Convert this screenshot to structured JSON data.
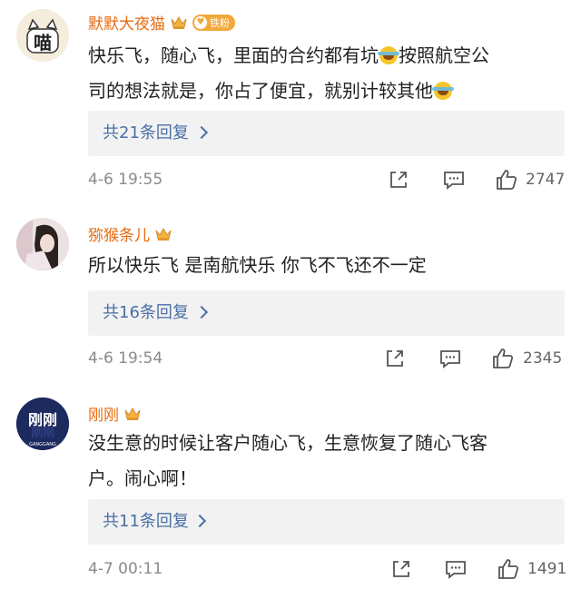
{
  "colors": {
    "username": "#e86b0f",
    "reply_link": "#4a6fa5",
    "timestamp": "#8a8a8a",
    "reply_bg": "#f2f2f2",
    "fan_badge": "#f2a83b"
  },
  "icons": [
    "crown-icon",
    "share-icon",
    "comment-icon",
    "like-icon",
    "chevron-right-icon",
    "laugh-cry-emoji"
  ],
  "comments": [
    {
      "username": "默默大夜猫",
      "fan_badge": "铁粉",
      "text_line1": "快乐飞，随心飞，里面的合约都有坑",
      "text_line1b": "按照航空公",
      "text_line2": "司的想法就是，你占了便宜，就别计较其他",
      "reply_link": "共21条回复",
      "timestamp": "4-6 19:55",
      "likes": "2747"
    },
    {
      "username": "猕猴条儿",
      "text": "所以快乐飞 是南航快乐 你飞不飞还不一定",
      "reply_link": "共16条回复",
      "timestamp": "4-6 19:54",
      "likes": "2345"
    },
    {
      "username": "刚刚",
      "avatar_text": "刚刚",
      "avatar_sub": "GANGGANG",
      "text_line1": "没生意的时候让客户随心飞，生意恢复了随心飞客",
      "text_line2": "户。闹心啊！",
      "reply_link": "共11条回复",
      "timestamp": "4-7 00:11",
      "likes": "1491"
    }
  ]
}
